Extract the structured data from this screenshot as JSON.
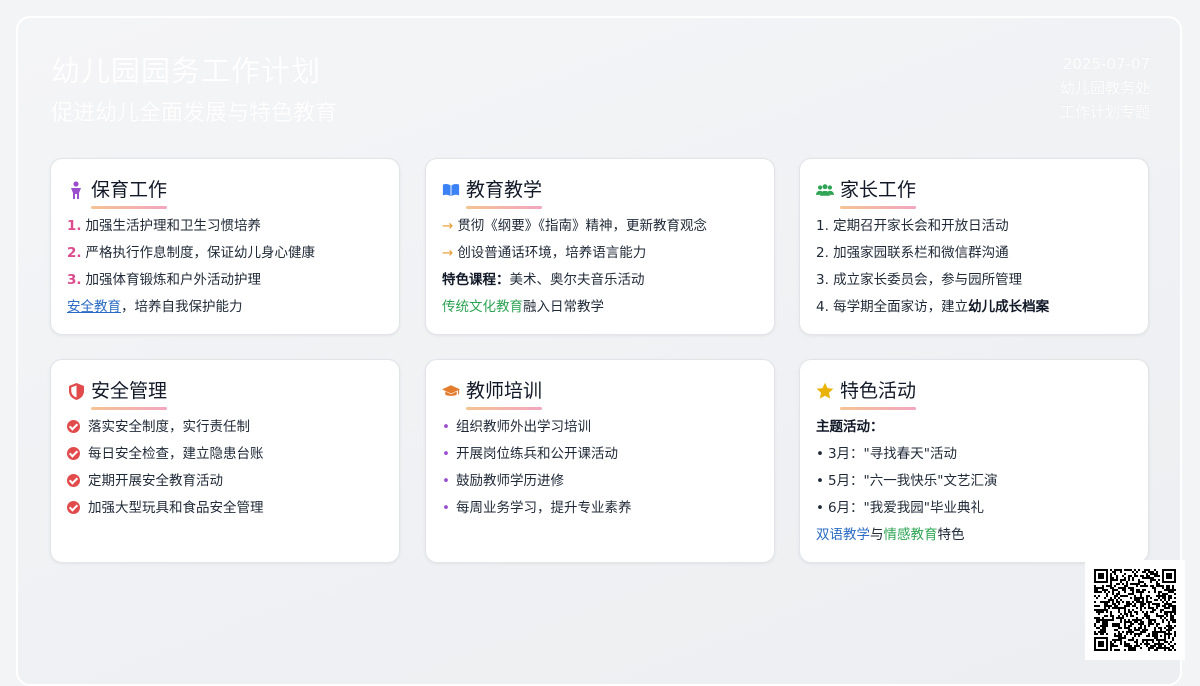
{
  "header": {
    "title": "幼儿园园务工作计划",
    "subtitle": "促进幼儿全面发展与特色教育",
    "date": "2025-07-07",
    "department": "幼儿园教务处",
    "topic": "工作计划专题"
  },
  "cards": {
    "care": {
      "title": "保育工作",
      "icon": "child-icon",
      "items": [
        "加强生活护理和卫生习惯培养",
        "严格执行作息制度，保证幼儿身心健康",
        "加强体育锻炼和户外活动护理"
      ],
      "numbers": [
        "1.",
        "2.",
        "3."
      ],
      "extra_link": "安全教育",
      "extra_rest": "，培养自我保护能力"
    },
    "teaching": {
      "title": "教育教学",
      "icon": "book-icon",
      "items": [
        "贯彻《纲要》《指南》精神，更新教育观念",
        "创设普通话环境，培养语言能力"
      ],
      "feature_label": "特色课程：",
      "feature_text": "美术、奥尔夫音乐活动",
      "culture_highlight": "传统文化教育",
      "culture_rest": "融入日常教学"
    },
    "parents": {
      "title": "家长工作",
      "icon": "users-icon",
      "items": [
        "1. 定期召开家长会和开放日活动",
        "2. 加强家园联系栏和微信群沟通",
        "3. 成立家长委员会，参与园所管理"
      ],
      "last_prefix": "4. 每学期全面家访，建立",
      "last_bold": "幼儿成长档案"
    },
    "safety": {
      "title": "安全管理",
      "icon": "shield-icon",
      "items": [
        "落实安全制度，实行责任制",
        "每日安全检查，建立隐患台账",
        "定期开展安全教育活动",
        "加强大型玩具和食品安全管理"
      ]
    },
    "training": {
      "title": "教师培训",
      "icon": "graduation-cap-icon",
      "items": [
        "组织教师外出学习培训",
        "开展岗位练兵和公开课活动",
        "鼓励教师学历进修",
        "每周业务学习，提升专业素养"
      ]
    },
    "activities": {
      "title": "特色活动",
      "icon": "star-icon",
      "theme_label": "主题活动：",
      "items": [
        "3月：\"寻找春天\"活动",
        "5月：\"六一我快乐\"文艺汇演",
        "6月：\"我爱我园\"毕业典礼"
      ],
      "bilingual": "双语教学",
      "and": "与",
      "emotion": "情感教育",
      "tail": "特色"
    }
  },
  "colors": {
    "accent_pink": "#db4b8e",
    "accent_orange": "#e59a2a",
    "accent_red": "#e14b4b",
    "accent_purple": "#9b4fcf",
    "accent_green": "#2ea454",
    "accent_blue": "#2b6cc4"
  }
}
